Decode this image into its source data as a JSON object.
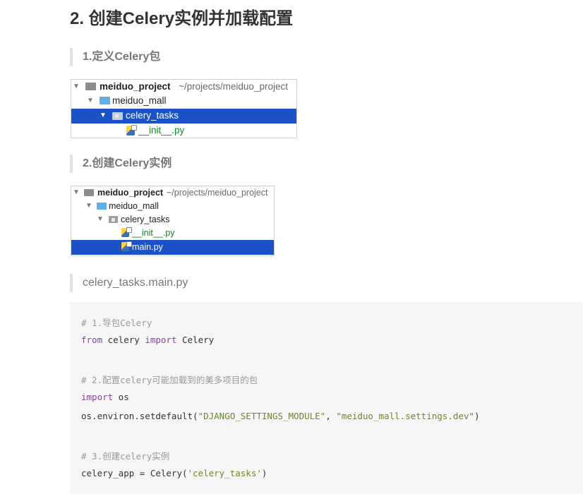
{
  "heading": "2. 创建Celery实例并加载配置",
  "section1": {
    "title": "1.定义Celery包",
    "tree": {
      "project": "meiduo_project",
      "project_path": "~/projects/meiduo_project",
      "mall": "meiduo_mall",
      "tasks": "celery_tasks",
      "init": "__init__.py"
    }
  },
  "section2": {
    "title": "2.创建Celery实例",
    "tree": {
      "project": "meiduo_project",
      "project_path": "~/projects/meiduo_project",
      "mall": "meiduo_mall",
      "tasks": "celery_tasks",
      "init": "__init__.py",
      "main": "main.py"
    }
  },
  "file_label": "celery_tasks.main.py",
  "code": {
    "c1": "# 1.导包Celery",
    "l1_kw1": "from",
    "l1_mid": " celery ",
    "l1_kw2": "import",
    "l1_end": " Celery",
    "c2": "# 2.配置celery可能加载到的美多项目的包",
    "l2_kw": "import",
    "l2_end": " os",
    "l3_pre": "os.environ.setdefault(",
    "l3_s1": "\"DJANGO_SETTINGS_MODULE\"",
    "l3_mid": ", ",
    "l3_s2": "\"meiduo_mall.settings.dev\"",
    "l3_end": ")",
    "c3": "# 3.创建celery实例",
    "l4_pre": "celery_app = Celery(",
    "l4_s": "'celery_tasks'",
    "l4_end": ")"
  }
}
